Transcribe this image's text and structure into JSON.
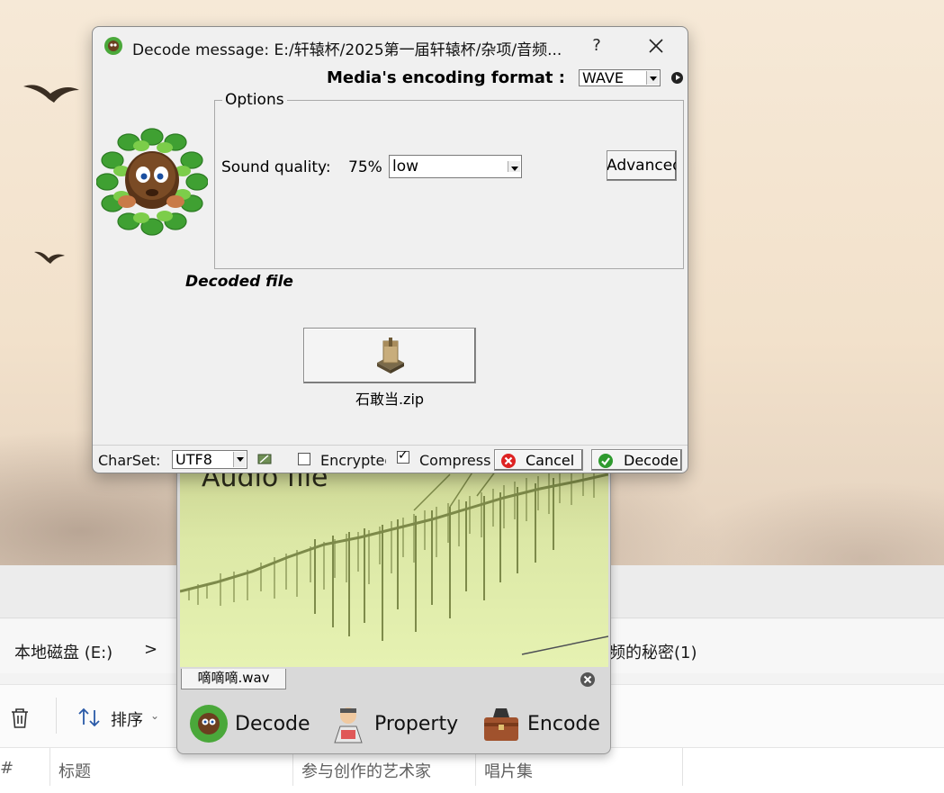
{
  "explorer": {
    "breadcrumb_drive": "本地磁盘 (E:)",
    "breadcrumb_sep": ">",
    "breadcrumb_tail": "频的秘密(1)",
    "sort_label": "排序",
    "columns": [
      "#",
      "标题",
      "参与创作的艺术家",
      "唱片集"
    ]
  },
  "dialog": {
    "title": "Decode message: E:/轩辕杯/2025第一届轩辕杯/杂项/音频...",
    "help": "?",
    "format_label": "Media's encoding format :",
    "format_value": "WAVE",
    "options_legend": "Options",
    "sound_quality_label": "Sound quality:",
    "sound_quality_pct": "75%",
    "sound_quality_value": "low",
    "advanced_label": "Advanced",
    "decoded_file_label": "Decoded file",
    "decoded_file_name": "石敢当.zip",
    "footer": {
      "charset_label": "CharSet:",
      "charset_value": "UTF8",
      "encrypted_label": "Encrypted",
      "encrypted_checked": false,
      "compress_label": "Compress",
      "compress_checked": true,
      "cancel_label": "Cancel",
      "decode_label": "Decode"
    }
  },
  "audio_window": {
    "image_title": "Audio file",
    "file_tab": "嘀嘀嘀.wav",
    "buttons": {
      "decode": "Decode",
      "property": "Property",
      "encode": "Encode"
    }
  },
  "colors": {
    "dialog_bg": "#f0f0f0",
    "audio_green": "#dce8a6",
    "decode_green": "#2e9a2e",
    "cancel_red": "#cc2222"
  }
}
